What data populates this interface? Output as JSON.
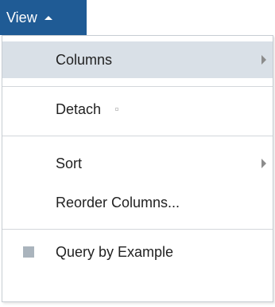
{
  "view_button": {
    "label": "View"
  },
  "menu": {
    "items": [
      {
        "label": "Columns",
        "has_submenu": true,
        "highlighted": true
      },
      {
        "label": "Detach",
        "has_submenu": false
      },
      {
        "label": "Sort",
        "has_submenu": true
      },
      {
        "label": "Reorder Columns...",
        "has_submenu": false
      },
      {
        "label": "Query by Example",
        "has_submenu": false,
        "checkable": true,
        "checked": false
      }
    ]
  },
  "colors": {
    "view_button_bg": "#1f5b95",
    "highlight_bg": "#d9e0e7",
    "text": "#222222"
  }
}
